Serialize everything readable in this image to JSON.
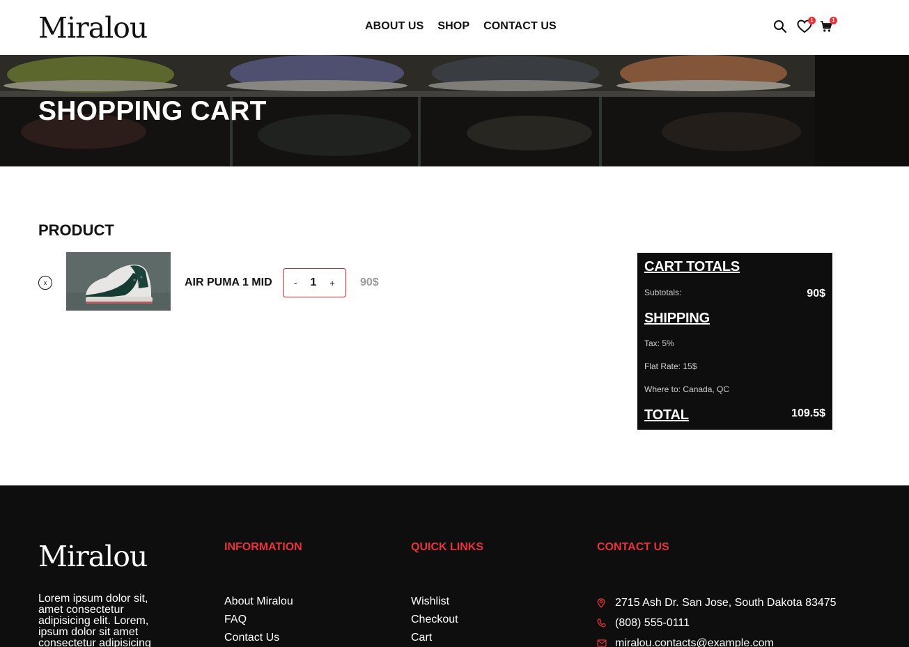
{
  "brand": {
    "logo_text": "Miralou"
  },
  "nav": {
    "items": [
      "ABOUT US",
      "SHOP",
      "CONTACT US"
    ]
  },
  "header_icons": {
    "search": "search-icon",
    "wishlist": {
      "icon": "heart-icon",
      "badge": "1"
    },
    "cart": {
      "icon": "cart-icon",
      "badge": "1"
    }
  },
  "banner": {
    "title": "SHOPPING CART"
  },
  "cart": {
    "heading": "PRODUCT",
    "remove_label": "x",
    "item": {
      "name": "AIR PUMA 1 MID",
      "quantity": "1",
      "minus": "-",
      "plus": "+",
      "price": "90$"
    }
  },
  "totals": {
    "title": "CART TOTALS",
    "subtotals_label": "Subtotals:",
    "subtotals_value": "90$",
    "shipping_title": "SHIPPING",
    "tax": "Tax: 5%",
    "flat_rate": "Flat Rate: 15$",
    "where_to": "Where to: Canada, QC",
    "total_label": "TOTAL",
    "total_value": "109.5$"
  },
  "footer": {
    "logo_text": "Miralou",
    "about_text": "Lorem ipsum dolor sit, amet consectetur adipisicing elit. Lorem, ipsum dolor sit amet consectetur adipisicing",
    "information": {
      "title": "INFORMATION",
      "links": [
        "About Miralou",
        "FAQ",
        "Contact Us"
      ]
    },
    "quick_links": {
      "title": "QUICK LINKS",
      "links": [
        "Wishlist",
        "Checkout",
        "Cart"
      ]
    },
    "contact": {
      "title": "CONTACT US",
      "address": "2715 Ash Dr. San Jose, South Dakota 83475",
      "phone": "(808) 555-0111",
      "email": "miralou.contacts@example.com"
    }
  },
  "colors": {
    "accent": "#e8333a",
    "dark": "#0e0e0e",
    "muted_price": "#999999"
  }
}
